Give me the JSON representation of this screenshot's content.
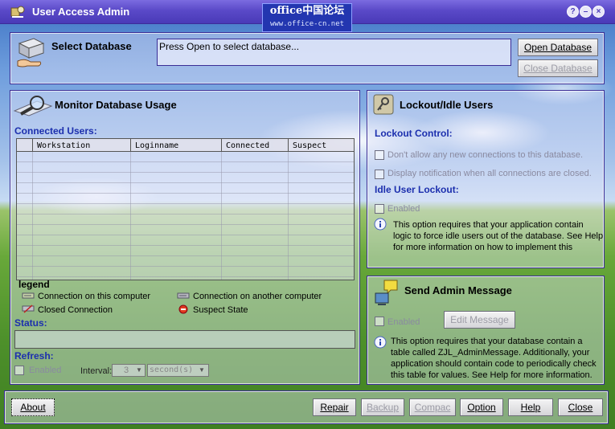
{
  "window": {
    "title": "User Access Admin",
    "controls": {
      "help": "?",
      "minimize": "–",
      "close": "×"
    }
  },
  "watermark": {
    "line1": "office中国论坛",
    "line2": "www.office-cn.net"
  },
  "select_database": {
    "title": "Select Database",
    "path_placeholder": "Press Open to select database...",
    "open_label": "Open Database",
    "close_label": "Close Database"
  },
  "monitor": {
    "title": "Monitor Database Usage",
    "connected_users_label": "Connected Users:",
    "columns": [
      "Workstation",
      "Loginname",
      "Connected",
      "Suspect"
    ],
    "legend": {
      "title": "legend",
      "items": [
        "Connection on this computer",
        "Connection on another computer",
        "Closed Connection",
        "Suspect State"
      ]
    },
    "status_label": "Status:",
    "refresh_label": "Refresh:",
    "refresh_enabled_label": "Enabled",
    "interval_label": "Interval:",
    "interval_value": "3",
    "interval_unit": "second(s)"
  },
  "lockout": {
    "title": "Lockout/Idle Users",
    "lockout_control_label": "Lockout Control:",
    "no_new_connections": "Don't allow any new connections to this database.",
    "display_notification": "Display notification when all connections are closed.",
    "idle_label": "Idle User Lockout:",
    "idle_enabled": "Enabled",
    "info": "This option requires that your application contain logic to force idle users out of the database. See Help for more information on how to implement this functionality."
  },
  "admin_message": {
    "title": "Send Admin Message",
    "enabled_label": "Enabled",
    "edit_label": "Edit Message",
    "info": "This option requires that your database contain a table called ZJL_AdminMessage. Additionally, your application should contain code to periodically check this table for values. See Help for more information."
  },
  "footer": {
    "about": "About",
    "repair": "Repair",
    "backup": "Backup",
    "compact": "Compac",
    "option": "Option",
    "help": "Help",
    "close": "Close"
  },
  "colors": {
    "panel_border": "#3a2d96",
    "section_label": "#1c2fae",
    "titlebar": "#5a49c8"
  }
}
